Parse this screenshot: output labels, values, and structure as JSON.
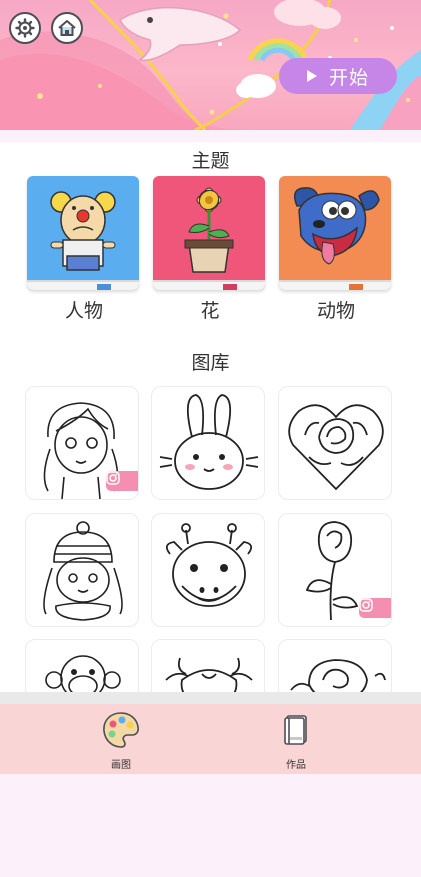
{
  "header": {
    "start_label": "开始"
  },
  "sections": {
    "themes_title": "主题",
    "gallery_title": "图库"
  },
  "themes": [
    {
      "label": "人物",
      "color": "#5aaef0"
    },
    {
      "label": "花",
      "color": "#f0567a"
    },
    {
      "label": "动物",
      "color": "#f28c52"
    }
  ],
  "gallery": [
    {
      "subject": "girl",
      "instagram": true
    },
    {
      "subject": "bunny",
      "instagram": false
    },
    {
      "subject": "rose-heart",
      "instagram": false
    },
    {
      "subject": "child-winter-hat",
      "instagram": false
    },
    {
      "subject": "giraffe",
      "instagram": false
    },
    {
      "subject": "rose",
      "instagram": true
    },
    {
      "subject": "monkey",
      "instagram": false
    },
    {
      "subject": "cow",
      "instagram": false
    },
    {
      "subject": "rose",
      "instagram": false
    }
  ],
  "bottom_nav": [
    {
      "label": "画图",
      "icon": "palette-icon"
    },
    {
      "label": "作品",
      "icon": "book-icon"
    }
  ],
  "colors": {
    "accent": "#c586e8",
    "nav_bg": "#f9d5d5",
    "page_bg": "#fcf0fa"
  }
}
